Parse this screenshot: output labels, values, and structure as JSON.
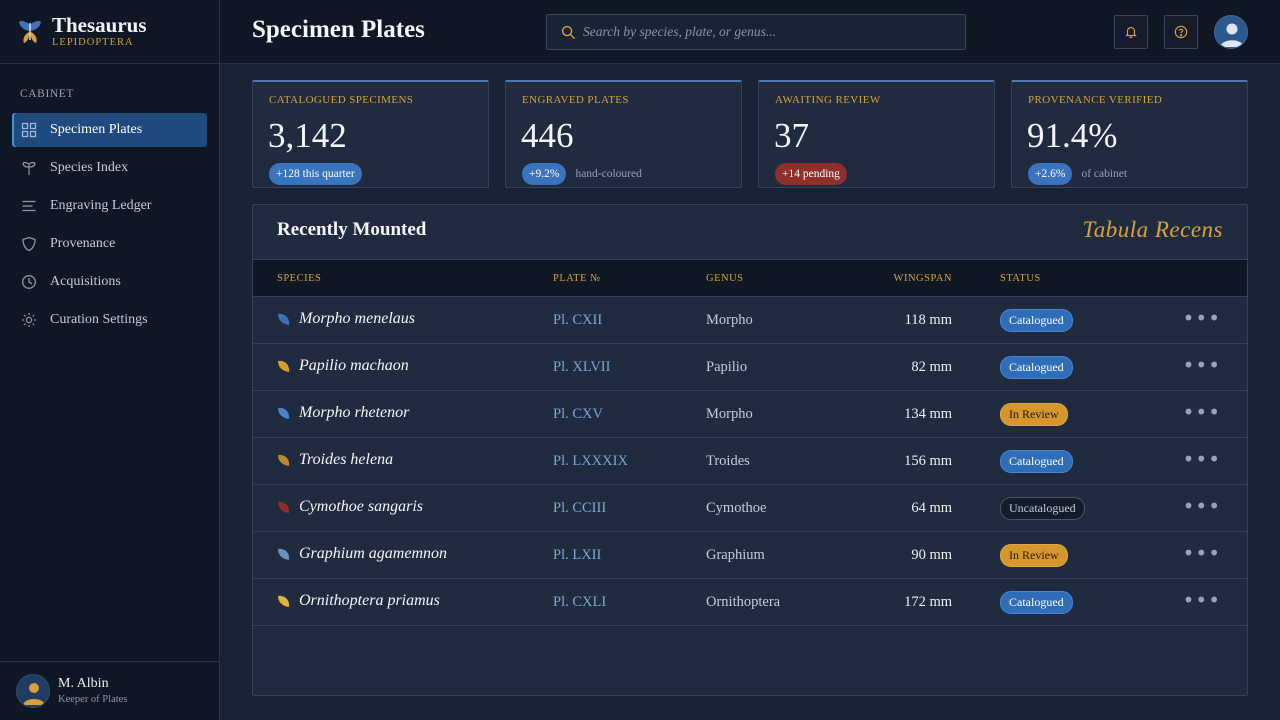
{
  "brand": {
    "name": "Thesaurus",
    "subtitle": "LEPIDOPTERA"
  },
  "sidebar": {
    "section_label": "CABINET",
    "items": [
      {
        "label": "Specimen Plates",
        "icon": "grid-icon",
        "active": true
      },
      {
        "label": "Species Index",
        "icon": "lepidoptera-icon",
        "active": false
      },
      {
        "label": "Engraving Ledger",
        "icon": "list-icon",
        "active": false
      },
      {
        "label": "Provenance",
        "icon": "shield-icon",
        "active": false
      },
      {
        "label": "Acquisitions",
        "icon": "clock-icon",
        "active": false
      },
      {
        "label": "Curation Settings",
        "icon": "sun-gear-icon",
        "active": false
      }
    ],
    "user": {
      "name": "M. Albin",
      "role": "Keeper of Plates"
    }
  },
  "header": {
    "title": "Specimen Plates",
    "search_placeholder": "Search by species, plate, or genus..."
  },
  "stats": [
    {
      "label": "CATALOGUED SPECIMENS",
      "value": "3,142",
      "pill": "+128 this quarter",
      "pill_color": "blue",
      "note": ""
    },
    {
      "label": "ENGRAVED PLATES",
      "value": "446",
      "pill": "+9.2%",
      "pill_color": "blue",
      "note": "hand-coloured"
    },
    {
      "label": "AWAITING REVIEW",
      "value": "37",
      "pill": "+14 pending",
      "pill_color": "red",
      "note": ""
    },
    {
      "label": "PROVENANCE VERIFIED",
      "value": "91.4%",
      "pill": "+2.6%",
      "pill_color": "blue",
      "note": "of cabinet"
    }
  ],
  "table": {
    "title": "Recently Mounted",
    "tag": "Tabula Recens",
    "columns": [
      "SPECIES",
      "PLATE №",
      "GENUS",
      "WINGSPAN",
      "STATUS"
    ],
    "rows": [
      {
        "species": "Morpho menelaus",
        "plate": "Pl. CXII",
        "genus": "Morpho",
        "wingspan": "118 mm",
        "status": "Catalogued",
        "status_kind": "catalogued",
        "leaf_color": "#3f73b8"
      },
      {
        "species": "Papilio machaon",
        "plate": "Pl. XLVII",
        "genus": "Papilio",
        "wingspan": "82 mm",
        "status": "Catalogued",
        "status_kind": "catalogued",
        "leaf_color": "#d89b2e"
      },
      {
        "species": "Morpho rhetenor",
        "plate": "Pl. CXV",
        "genus": "Morpho",
        "wingspan": "134 mm",
        "status": "In Review",
        "status_kind": "review",
        "leaf_color": "#4b82c6"
      },
      {
        "species": "Troides helena",
        "plate": "Pl. LXXXIX",
        "genus": "Troides",
        "wingspan": "156 mm",
        "status": "Catalogued",
        "status_kind": "catalogued",
        "leaf_color": "#b98a2e"
      },
      {
        "species": "Cymothoe sangaris",
        "plate": "Pl. CCIII",
        "genus": "Cymothoe",
        "wingspan": "64 mm",
        "status": "Uncatalogued",
        "status_kind": "uncat",
        "leaf_color": "#8e2f2c"
      },
      {
        "species": "Graphium agamemnon",
        "plate": "Pl. LXII",
        "genus": "Graphium",
        "wingspan": "90 mm",
        "status": "In Review",
        "status_kind": "review",
        "leaf_color": "#6b8fbf"
      },
      {
        "species": "Ornithoptera priamus",
        "plate": "Pl. CXLI",
        "genus": "Ornithoptera",
        "wingspan": "172 mm",
        "status": "Catalogued",
        "status_kind": "catalogued",
        "leaf_color": "#e0b03c"
      }
    ]
  },
  "colors": {
    "accent_gold": "#d8a23a",
    "accent_blue": "#3a74bf",
    "danger": "#8e2f2c"
  }
}
